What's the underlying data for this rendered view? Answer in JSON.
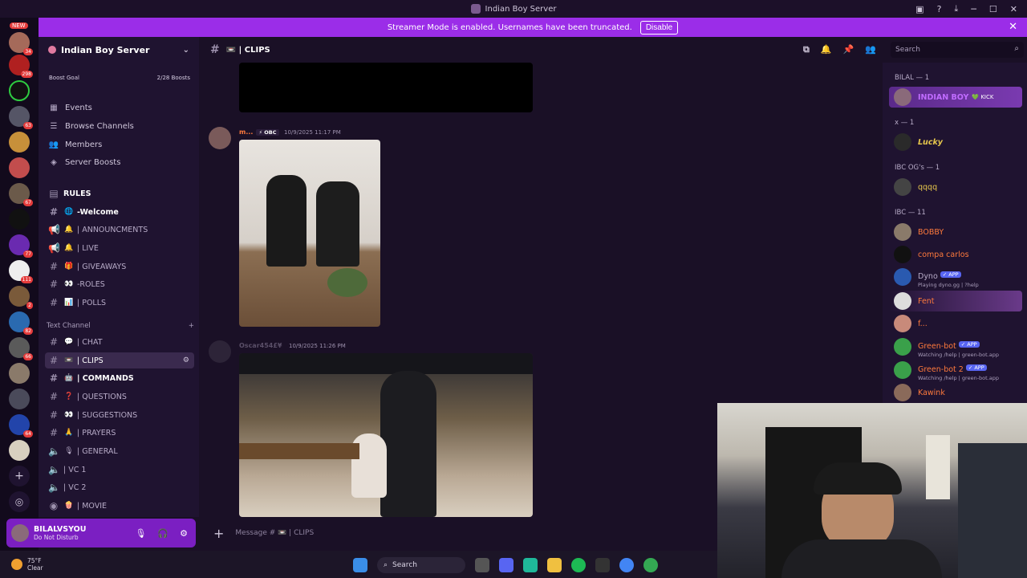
{
  "window": {
    "title": "Indian Boy Server"
  },
  "banner": {
    "text": "Streamer Mode is enabled. Usernames have been truncated.",
    "button": "Disable"
  },
  "rail": {
    "new_label": "NEW",
    "badges": [
      "34",
      "298",
      "63",
      "67",
      "77",
      "111",
      "2",
      "82",
      "66",
      "64"
    ]
  },
  "server": {
    "name": "Indian Boy Server",
    "boost_goal": "Boost Goal",
    "boost_count": "2/28 Boosts"
  },
  "nav": [
    "Events",
    "Browse Channels",
    "Members",
    "Server Boosts"
  ],
  "channels_top": [
    {
      "emoji": "",
      "name": "RULES"
    },
    {
      "emoji": "🌐",
      "name": "-Welcome"
    },
    {
      "emoji": "🔔",
      "name": "| ANNOUNCMENTS"
    },
    {
      "emoji": "🔔",
      "name": "| LIVE"
    },
    {
      "emoji": "🎁",
      "name": "| GIVEAWAYS"
    },
    {
      "emoji": "👀",
      "name": "-ROLES"
    },
    {
      "emoji": "📊",
      "name": "| POLLS"
    }
  ],
  "category": {
    "name": "Text Channel"
  },
  "channels_text": [
    {
      "emoji": "💬",
      "name": "| CHAT"
    },
    {
      "emoji": "📼",
      "name": "| CLIPS"
    },
    {
      "emoji": "🤖",
      "name": "| COMMANDS"
    },
    {
      "emoji": "❓",
      "name": "| QUESTIONS"
    },
    {
      "emoji": "👀",
      "name": "| SUGGESTIONS"
    },
    {
      "emoji": "🙏",
      "name": "| PRAYERS"
    },
    {
      "emoji": "🎙",
      "name": "| GENERAL"
    },
    {
      "emoji": "",
      "name": "| VC 1"
    },
    {
      "emoji": "",
      "name": "| VC 2"
    },
    {
      "emoji": "🍿",
      "name": "| MOVIE"
    }
  ],
  "user": {
    "name": "BILALVSYOU",
    "status": "Do Not Disturb"
  },
  "header": {
    "channel": "📼 | CLIPS",
    "search_placeholder": "Search"
  },
  "messages": [
    {
      "author": "m...",
      "tag": "⚡ OBC",
      "time": "10/9/2025 11:17 PM"
    },
    {
      "author": "Oscar454£¥",
      "tag": "",
      "time": "10/9/2025 11:26 PM"
    }
  ],
  "composer": {
    "placeholder": "Message # 📼 | CLIPS"
  },
  "members": {
    "groups": [
      {
        "title": "BILAL — 1"
      },
      {
        "title": "x — 1"
      },
      {
        "title": "IBC OG's — 1"
      },
      {
        "title": "IBC — 11"
      }
    ],
    "list": [
      {
        "name": "INDIAN BOY",
        "sub": "💚 KICK",
        "color": "#c06cff"
      },
      {
        "name": "Lucky",
        "sub": "",
        "color": "#e8c84c"
      },
      {
        "name": "qqqq",
        "sub": "",
        "color": "#e8c84c"
      },
      {
        "name": "BOBBY",
        "sub": "",
        "color": "#ff7a3c"
      },
      {
        "name": "compa carlos",
        "sub": "",
        "color": "#ff7a3c"
      },
      {
        "name": "Dyno",
        "sub": "Playing dyno.gg | ?help",
        "color": "#b7abc7",
        "app": "✓ APP"
      },
      {
        "name": "Fent",
        "sub": "",
        "color": "#ff7a3c"
      },
      {
        "name": "f...",
        "sub": "",
        "color": "#ff7a3c"
      },
      {
        "name": "Green-bot",
        "sub": "Watching /help | green-bot.app",
        "color": "#ff7a3c",
        "app": "✓ APP"
      },
      {
        "name": "Green-bot 2",
        "sub": "Watching /help | green-bot.app",
        "color": "#ff7a3c",
        "app": "✓ APP"
      },
      {
        "name": "Kawink",
        "sub": "",
        "color": "#ff7a3c"
      }
    ]
  },
  "taskbar": {
    "temp": "75°F",
    "condition": "Clear",
    "search": "Search"
  },
  "colors": {
    "banner": "#9b2de8",
    "user_panel": "#7b1fc2",
    "background": "#1a1026",
    "accent_orange": "#ff7a3c"
  }
}
